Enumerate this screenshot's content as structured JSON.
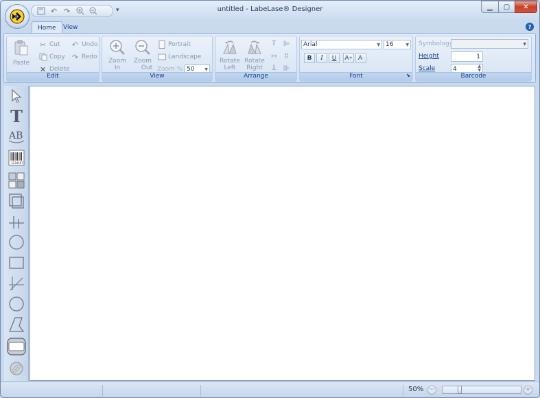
{
  "window": {
    "title": "untitled - LabeLase® Designer",
    "controls": {
      "minimize_icon": "minimize-icon",
      "maximize_icon": "maximize-icon",
      "close_icon": "close-icon"
    }
  },
  "quick_access": {
    "items": [
      "save-icon",
      "undo-icon",
      "redo-icon",
      "zoom-in-icon",
      "zoom-out-icon"
    ],
    "customize_icon": "customize-toolbar-icon"
  },
  "tabs": [
    {
      "label": "Home",
      "active": true
    },
    {
      "label": "View",
      "active": false
    }
  ],
  "ribbon": {
    "edit": {
      "label": "Edit",
      "paste": "Paste",
      "cut": "Cut",
      "copy": "Copy",
      "delete": "Delete",
      "undo": "Undo",
      "redo": "Redo"
    },
    "view": {
      "label": "View",
      "zoom_in": [
        "Zoom In"
      ],
      "zoom_out": [
        "Zoom",
        "Out"
      ],
      "portrait": "Portrait",
      "landscape": "Landscape",
      "zoom_percent_label": "Zoom %",
      "zoom_percent_value": "50"
    },
    "arrange": {
      "label": "Arrange",
      "rotate_left": [
        "Rotate",
        "Left"
      ],
      "rotate_right": [
        "Rotate",
        "Right"
      ]
    },
    "font": {
      "label": "Font",
      "family": "Arial",
      "size": "16",
      "bold": "B",
      "italic": "I",
      "underline": "U",
      "grow": "A",
      "shrink": "A"
    },
    "barcode": {
      "label": "Barcode",
      "symbology_label": "Symbology",
      "symbology_value": "",
      "height_label": "Height",
      "height_value": "1",
      "scale_label": "Scale",
      "scale_value": "4"
    }
  },
  "toolbox": [
    "pointer-tool-icon",
    "text-tool-icon",
    "arc-text-tool-icon",
    "barcode-tool-icon",
    "image-tool-icon",
    "frame-tool-icon",
    "crosshair-tool-icon",
    "circle-tool-icon",
    "rectangle-tool-icon",
    "line-tool-icon",
    "ellipse-tool-icon",
    "polygon-tool-icon",
    "rounded-rect-tool-icon",
    "fill-tool-icon"
  ],
  "statusbar": {
    "zoom_level": "50%",
    "zoom_fraction": 0.2
  },
  "colors": {
    "accent": "#15428b",
    "ribbon_bg": "#d4e2f3",
    "close_button": "#c8422b"
  }
}
